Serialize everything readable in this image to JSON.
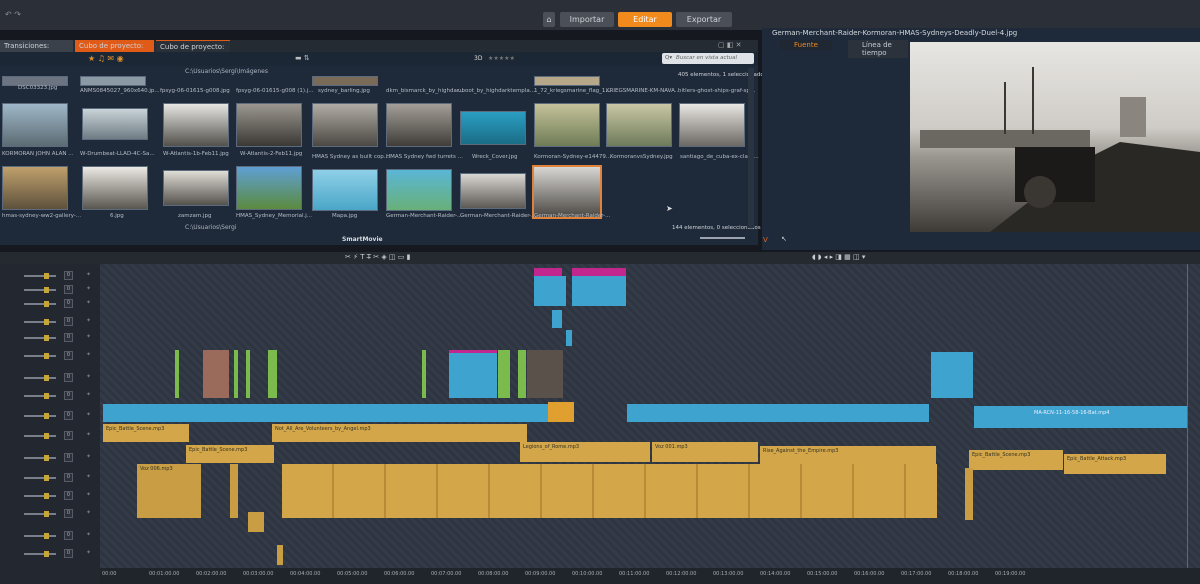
{
  "nav": {
    "import": "Importar",
    "edit": "Editar",
    "export": "Exportar"
  },
  "library": {
    "tabs": [
      "Transiciones: (todos)",
      "Cubo de proyecto: 20...",
      "Cubo de proyecto: 20..."
    ],
    "path": "C:\\Usuarios\\Sergi\\Imágenes",
    "path2": "C:\\Usuarios\\Sergi",
    "search_placeholder": "Buscar en vista actual",
    "mode_3d": "3D",
    "count_top": "405 elementos, 1 seleccionados",
    "count_bottom": "144 elementos, 0 seleccionados",
    "smartmovie": "SmartMovie",
    "captions_row0": [
      "DSC03323.jpg",
      "ANMS0845027_960x640.jp...",
      "fpsyg-06-01615-g008.jpg",
      "fpsyg-06-01615-g008 (1).j...",
      "sydney_barling.jpg",
      "dkm_bismarck_by_highdar...",
      "uboot_by_highdarktempla...",
      "1_72_kriegsmarine_flag_1...",
      "KRIEGSMARINE-KM-NAVA...",
      "hitlers-ghost-ships-graf-sp..."
    ],
    "captions_row1": [
      "KORMORAN JOHN ALAN ...",
      "W-Drumbeat-LLAD-4C-Sa...",
      "W-Atlantis-1b-Feb11.jpg",
      "W-Atlantis-2-Feb11.jpg",
      "HMAS Sydney as built cop...",
      "HMAS Sydney fwd turrets ...",
      "Wreck_Cover.jpg",
      "Kormoran-Sydney-e14479...",
      "KormoranvsSydney.jpg",
      "santiago_de_cuba-ex-clara..."
    ],
    "captions_row2": [
      "hmas-sydney-ww2-gallery-...",
      "6.jpg",
      "zamzam.jpg",
      "HMAS_Sydney_Memorial.j...",
      "Mapa.jpg",
      "German-Merchant-Raider-...",
      "German-Merchant-Raider-...",
      "German-Merchant-Raider-..."
    ]
  },
  "player": {
    "title": "German-Merchant-Raider-Kormoran-HMAS-Sydneys-Deadly-Duel-4.jpg",
    "tab_source": "Fuente",
    "tab_timeline": "Línea de tiempo"
  },
  "timeline": {
    "track_values": [
      "0",
      "0",
      "0",
      "0",
      "0",
      "0",
      "0",
      "0",
      "0",
      "0",
      "0",
      "0",
      "0",
      "0",
      "0",
      "0"
    ],
    "ruler": [
      "00:00",
      "00:01:00.00",
      "00:02:00.00",
      "00:03:00.00",
      "00:04:00.00",
      "00:05:00.00",
      "00:06:00.00",
      "00:07:00.00",
      "00:08:00.00",
      "00:09:00.00",
      "00:10:00.00",
      "00:11:00.00",
      "00:12:00.00",
      "00:13:00.00",
      "00:14:00.00",
      "00:15:00.00",
      "00:16:00.00",
      "00:17:00.00",
      "00:18:00.00",
      "00:19:00.00"
    ],
    "clip_labels": [
      "Epic_Battle_Scene.mp3",
      "Epic_Battle_Scene.mp3",
      "Not_All_Are_Volunteers_by_Angel.mp3",
      "Legions_of_Rome.mp3",
      "Rise_Against_the_Empire.mp3",
      "Epic_Battle_Scene.mp3",
      "Epic_Battle_Attack.mp3",
      "Voz 001.mp3",
      "Voz 006.mp3",
      "MA-RCN-11-16-58-16-Bat.mp4"
    ]
  },
  "colors": {
    "accent": "#f08a1c",
    "video": "#3ea4cf",
    "audio": "#d3a64a"
  }
}
